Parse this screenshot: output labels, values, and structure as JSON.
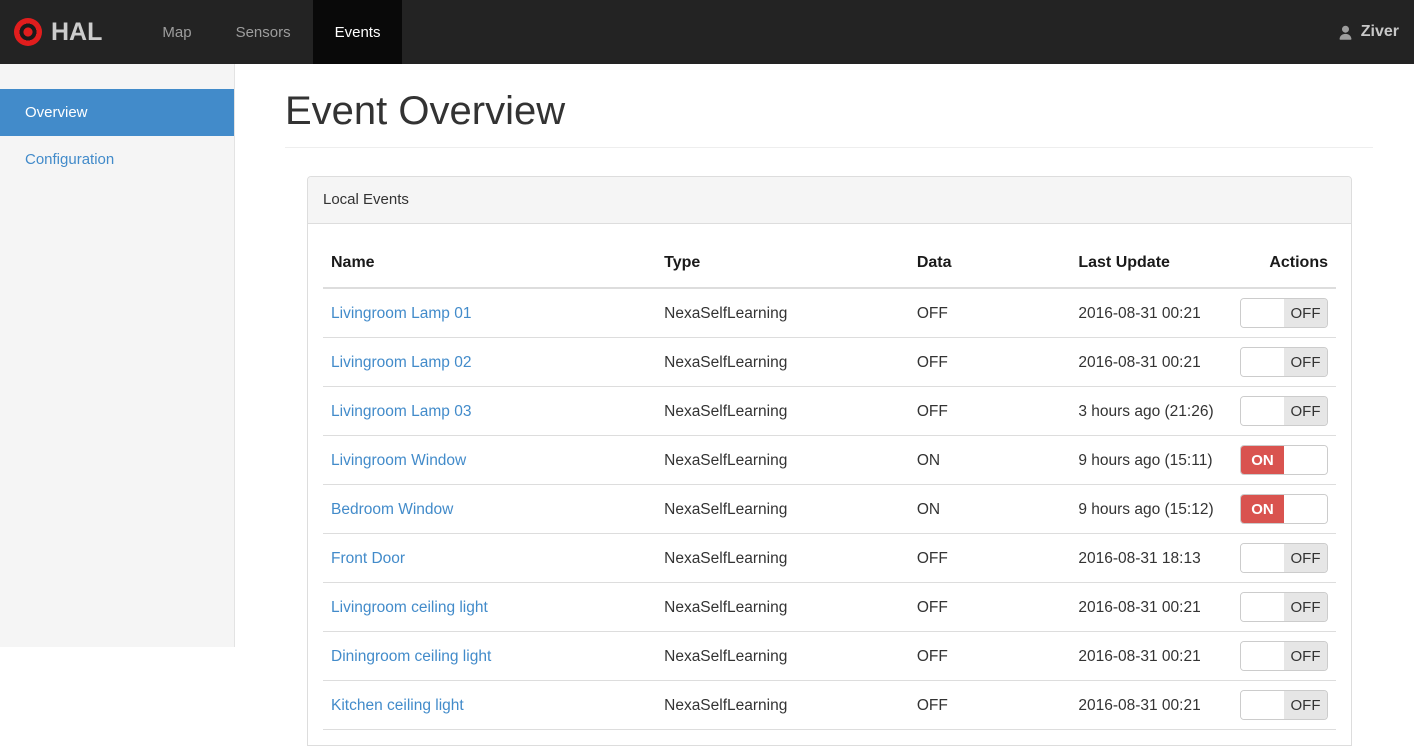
{
  "navbar": {
    "brand": "HAL",
    "links": [
      {
        "label": "Map",
        "active": false
      },
      {
        "label": "Sensors",
        "active": false
      },
      {
        "label": "Events",
        "active": true
      }
    ],
    "user": "Ziver"
  },
  "sidebar": {
    "items": [
      {
        "label": "Overview",
        "active": true
      },
      {
        "label": "Configuration",
        "active": false
      }
    ]
  },
  "main": {
    "title": "Event Overview",
    "panel": {
      "heading": "Local Events",
      "table": {
        "columns": [
          "Name",
          "Type",
          "Data",
          "Last Update",
          "Actions"
        ],
        "rows": [
          {
            "name": "Livingroom Lamp 01",
            "type": "NexaSelfLearning",
            "data": "OFF",
            "last_update": "2016-08-31 00:21",
            "switch_state": "OFF"
          },
          {
            "name": "Livingroom Lamp 02",
            "type": "NexaSelfLearning",
            "data": "OFF",
            "last_update": "2016-08-31 00:21",
            "switch_state": "OFF"
          },
          {
            "name": "Livingroom Lamp 03",
            "type": "NexaSelfLearning",
            "data": "OFF",
            "last_update": "3 hours ago (21:26)",
            "switch_state": "OFF"
          },
          {
            "name": "Livingroom Window",
            "type": "NexaSelfLearning",
            "data": "ON",
            "last_update": "9 hours ago (15:11)",
            "switch_state": "ON"
          },
          {
            "name": "Bedroom Window",
            "type": "NexaSelfLearning",
            "data": "ON",
            "last_update": "9 hours ago (15:12)",
            "switch_state": "ON"
          },
          {
            "name": "Front Door",
            "type": "NexaSelfLearning",
            "data": "OFF",
            "last_update": "2016-08-31 18:13",
            "switch_state": "OFF"
          },
          {
            "name": "Livingroom ceiling light",
            "type": "NexaSelfLearning",
            "data": "OFF",
            "last_update": "2016-08-31 00:21",
            "switch_state": "OFF"
          },
          {
            "name": "Diningroom ceiling light",
            "type": "NexaSelfLearning",
            "data": "OFF",
            "last_update": "2016-08-31 00:21",
            "switch_state": "OFF"
          },
          {
            "name": "Kitchen ceiling light",
            "type": "NexaSelfLearning",
            "data": "OFF",
            "last_update": "2016-08-31 00:21",
            "switch_state": "OFF"
          }
        ]
      }
    }
  },
  "colors": {
    "navbar_bg": "#232323",
    "navbar_active_bg": "#090909",
    "brand_red": "#e11d1d",
    "sidebar_bg": "#f5f5f5",
    "accent_blue": "#428bca",
    "switch_on_red": "#d9534f",
    "panel_heading_bg": "#f5f5f5"
  }
}
